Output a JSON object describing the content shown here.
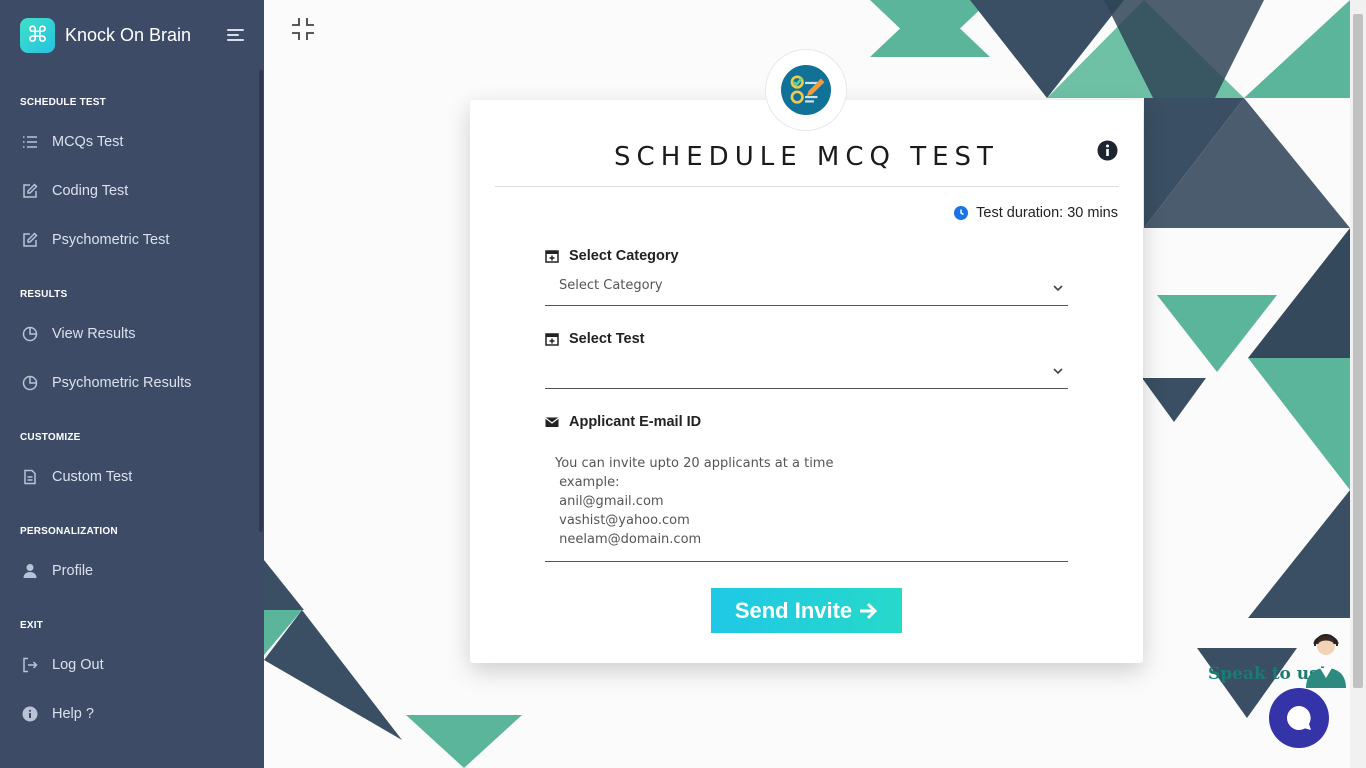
{
  "brand": {
    "name": "Knock On Brain",
    "logo_icon": "command-icon",
    "logo_glyph": "⌘"
  },
  "sidebar": {
    "sections": [
      {
        "title": "SCHEDULE TEST",
        "items": [
          {
            "label": "MCQs Test",
            "icon": "list-icon"
          },
          {
            "label": "Coding Test",
            "icon": "edit-icon"
          },
          {
            "label": "Psychometric Test",
            "icon": "edit-icon"
          }
        ]
      },
      {
        "title": "RESULTS",
        "items": [
          {
            "label": "View Results",
            "icon": "pie-chart-icon"
          },
          {
            "label": "Psychometric Results",
            "icon": "pie-chart-icon"
          }
        ]
      },
      {
        "title": "CUSTOMIZE",
        "items": [
          {
            "label": "Custom Test",
            "icon": "document-icon"
          }
        ]
      },
      {
        "title": "PERSONALIZATION",
        "items": [
          {
            "label": "Profile",
            "icon": "user-icon"
          }
        ]
      },
      {
        "title": "EXIT",
        "items": [
          {
            "label": "Log Out",
            "icon": "logout-icon"
          },
          {
            "label": "Help ?",
            "icon": "info-icon"
          }
        ]
      }
    ]
  },
  "card": {
    "title": "SCHEDULE MCQ TEST",
    "duration": "Test duration: 30 mins",
    "category": {
      "label": "Select Category",
      "value": "Select Category"
    },
    "test": {
      "label": "Select Test",
      "value": ""
    },
    "email": {
      "label": "Applicant E-mail ID",
      "placeholder_lines": [
        "You can invite upto 20 applicants at a time",
        " example:",
        " anil@gmail.com",
        " vashist@yahoo.com",
        " neelam@domain.com"
      ]
    },
    "send_label": "Send Invite"
  },
  "chat": {
    "speak_label": "Speak to us!"
  },
  "colors": {
    "sidebar": "#3d4b66",
    "accent": "#26d9c9",
    "teal": "#5bb59a",
    "navy": "#3a4f63",
    "chat": "#3434a8"
  }
}
